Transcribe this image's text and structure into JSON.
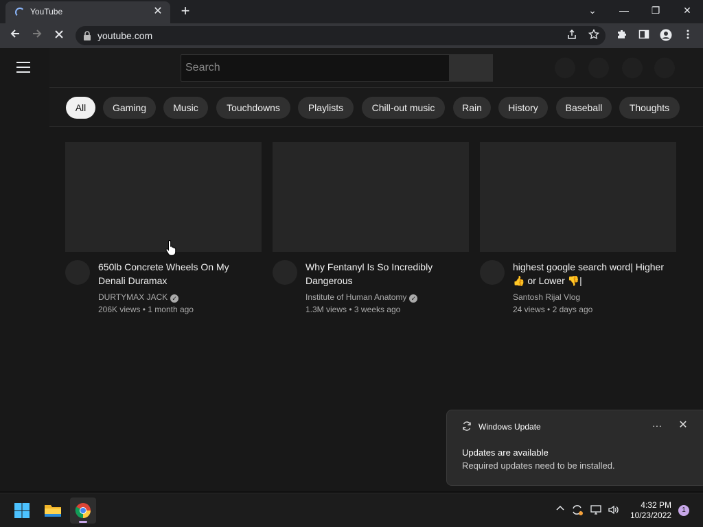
{
  "browser": {
    "tab_title": "YouTube",
    "tab_close": "✕",
    "new_tab": "+",
    "window_controls": {
      "dropdown": "⌄",
      "minimize": "—",
      "restore": "❐",
      "close": "✕"
    },
    "url": "youtube.com"
  },
  "youtube": {
    "search_placeholder": "Search",
    "chips": [
      "All",
      "Gaming",
      "Music",
      "Touchdowns",
      "Playlists",
      "Chill-out music",
      "Rain",
      "History",
      "Baseball",
      "Thoughts"
    ],
    "videos": [
      {
        "title": "650lb Concrete Wheels On My Denali Duramax",
        "channel": "DURTYMAX JACK",
        "views": "206K views",
        "age": "1 month ago"
      },
      {
        "title": "Why Fentanyl Is So Incredibly Dangerous",
        "channel": "Institute of Human Anatomy",
        "views": "1.3M views",
        "age": "3 weeks ago"
      },
      {
        "title": "highest google search word| Higher 👍 or Lower 👎|",
        "channel": "Santosh Rijal Vlog",
        "views": "24 views",
        "age": "2 days ago"
      }
    ],
    "meta_separator": "•"
  },
  "toast": {
    "app_name": "Windows Update",
    "more": "···",
    "close": "✕",
    "heading": "Updates are available",
    "body": "Required updates need to be installed."
  },
  "taskbar": {
    "time": "4:32 PM",
    "date": "10/23/2022",
    "notification_count": "1"
  }
}
